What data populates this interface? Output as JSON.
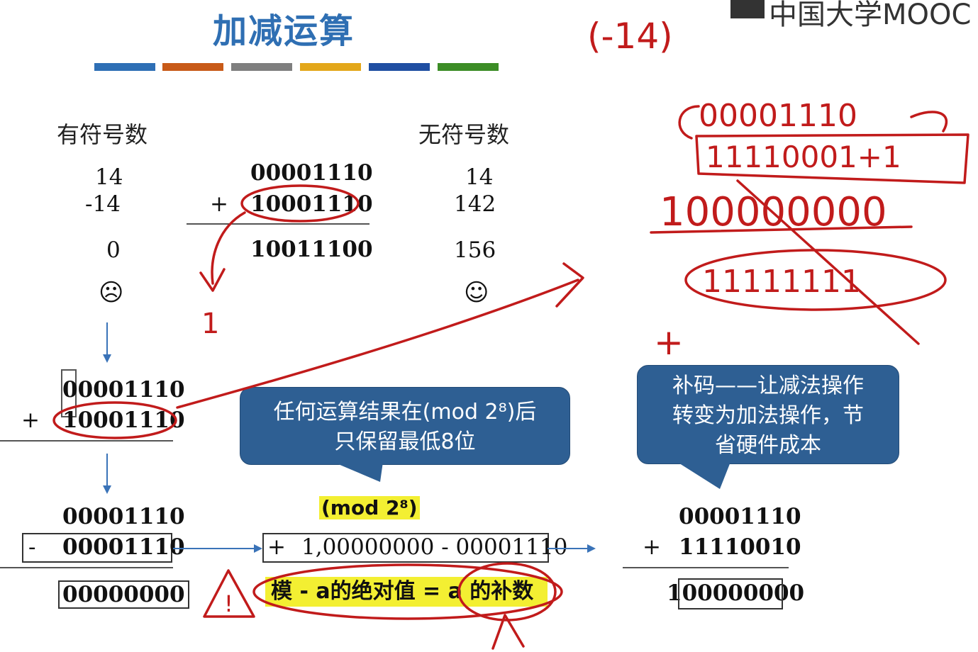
{
  "title": "加减运算",
  "logo": "中国大学MOOC",
  "color_bars": [
    "#2e6fb5",
    "#c85a18",
    "#7f7f7f",
    "#e3a71a",
    "#1f4ea2",
    "#3c8d26"
  ],
  "signed": {
    "heading": "有符号数",
    "a": "14",
    "b": "-14",
    "result": "0"
  },
  "binary": {
    "a": "00001110",
    "plus": "+",
    "b": "10001110",
    "result": "10011100"
  },
  "unsigned": {
    "heading": "无符号数",
    "a": "14",
    "b": "142",
    "result": "156"
  },
  "faces": {
    "sad": "☹",
    "happy": "☺"
  },
  "lower_add": {
    "plus": "+",
    "a": "00001110",
    "b": "10001110"
  },
  "callout_mod": {
    "line1": "任何运算结果在(mod 2⁸)后",
    "line2": "只保留最低8位"
  },
  "callout_complement": {
    "line1": "补码——让减法操作",
    "line2": "转变为加法操作，节",
    "line3": "省硬件成本"
  },
  "subtraction": {
    "a": "00001110",
    "minus": "-",
    "b": "00001110",
    "result": "00000000"
  },
  "mod_label": "(mod 2⁸)",
  "mod_expr": {
    "plus": "+",
    "text": "1,00000000 - 00001110"
  },
  "rule_text": "模 - a的绝对值 = a 的补数",
  "complement_add": {
    "a": "00001110",
    "plus": "+",
    "b": "11110010",
    "result": "100000000"
  },
  "handwriting": {
    "neg14": "(-14)",
    "bits1": "00001110",
    "bits2": "11110001+1",
    "bits3": "100000000",
    "bits4": "11111111",
    "plus": "+",
    "one": "1",
    "warn": "!"
  }
}
